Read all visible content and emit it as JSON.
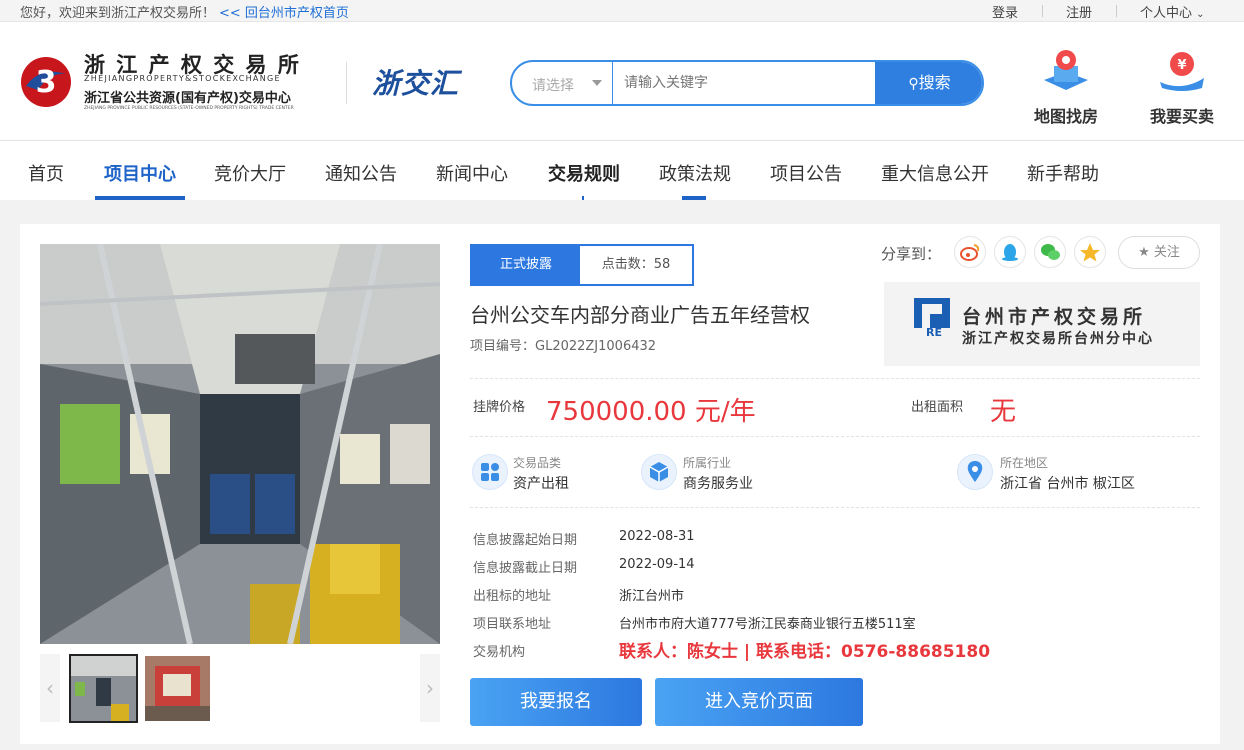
{
  "topbar": {
    "welcome": "您好，欢迎来到浙江产权交易所！",
    "back_link": "<< 回台州市产权首页",
    "login": "登录",
    "register": "注册",
    "personal_center": "个人中心"
  },
  "header": {
    "logo_cn": "浙 江 产 权 交 易 所",
    "logo_en": "ZHEJIANGPROPERTY&STOCKEXCHANGE",
    "logo_sub": "浙江省公共资源(国有产权)交易中心",
    "logo_sub_en": "ZHEJIANG PROVINCE PUBLIC RESOURCES (STATE-OWNED PROPERTY RIGHTS) TRADE CENTER",
    "brand2": "浙交汇",
    "search_select": "请选择",
    "search_placeholder": "请输入关键字",
    "search_button": "搜索",
    "map_find": "地图找房",
    "buy_sell": "我要买卖"
  },
  "nav": {
    "items": [
      "首页",
      "项目中心",
      "竞价大厅",
      "通知公告",
      "新闻中心",
      "交易规则",
      "政策法规",
      "项目公告",
      "重大信息公开",
      "新手帮助"
    ],
    "active": "项目中心"
  },
  "project": {
    "status_tab": "正式披露",
    "clicks_label": "点击数：58",
    "share_label": "分享到：",
    "follow": "关注",
    "title": "台州公交车内部分商业广告五年经营权",
    "code": "项目编号：GL2022ZJ1006432",
    "org_logo_title": "台州市产权交易所",
    "org_logo_sub": "浙江产权交易所台州分中心",
    "org_logo_mark": "RE",
    "price_label": "挂牌价格",
    "price_value": "750000.00 元/年",
    "area_label": "出租面积",
    "area_value": "无",
    "category_label": "交易品类",
    "category_value": "资产出租",
    "industry_label": "所属行业",
    "industry_value": "商务服务业",
    "region_label": "所在地区",
    "region_value": "浙江省 台州市 椒江区",
    "details": [
      {
        "label": "信息披露起始日期",
        "value": "2022-08-31"
      },
      {
        "label": "信息披露截止日期",
        "value": "2022-09-14"
      },
      {
        "label": "出租标的地址",
        "value": "浙江台州市"
      },
      {
        "label": "项目联系地址",
        "value": "台州市市府大道777号浙江民泰商业银行五楼511室"
      },
      {
        "label": "交易机构",
        "value": "联系人：陈女士 | 联系电话：0576-88685180"
      }
    ],
    "signup_button": "我要报名",
    "bid_button": "进入竞价页面"
  },
  "colors": {
    "primary": "#2c78e0",
    "price": "#e8383d"
  }
}
